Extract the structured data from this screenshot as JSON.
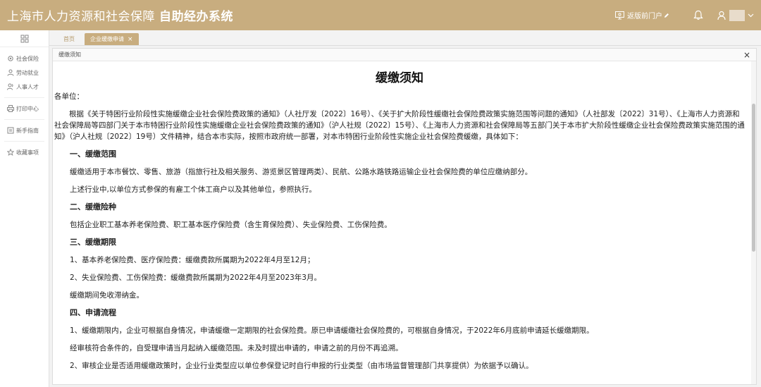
{
  "header": {
    "title_main": "上海市人力资源和社会保障",
    "title_sub": "自助经办系统",
    "link_label": "返版前门户",
    "colors": {
      "brand": "#c8ad7f"
    }
  },
  "sidebar": {
    "items": [
      {
        "label": "社会保险",
        "icon": "gear-icon"
      },
      {
        "label": "劳动就业",
        "icon": "person-icon"
      },
      {
        "label": "人事人才",
        "icon": "people-icon"
      },
      {
        "label": "打印中心",
        "icon": "printer-icon"
      },
      {
        "label": "新手指南",
        "icon": "guide-icon"
      },
      {
        "label": "收藏事项",
        "icon": "star-icon"
      }
    ]
  },
  "tabs": [
    {
      "label": "首页"
    },
    {
      "label": "企业缓缴申请"
    }
  ],
  "panel": {
    "title": "缓缴须知"
  },
  "doc": {
    "title": "缓缴须知",
    "salutation": "各单位：",
    "intro": "根据《关于特困行业阶段性实施缓缴企业社会保险费政策的通知》（人社厅发〔2022〕16号）、《关于扩大阶段性缓缴社会保险费政策实施范围等问题的通知》（人社部发〔2022〕31号）、《上海市人力资源和社会保障局等四部门关于本市特困行业阶段性实施缓缴企业社会保险费政策的通知》（沪人社规〔2022〕15号）、《上海市人力资源和社会保障局等五部门关于本市扩大阶段性缓缴企业社会保险费政策实施范围的通知》（沪人社规〔2022〕19号）文件精神，结合本市实际，按照市政府统一部署，对本市特困行业阶段性实施企业社会保险费缓缴，具体如下：",
    "sections": [
      {
        "heading": "一、缓缴范围",
        "items": [
          "缓缴适用于本市餐饮、零售、旅游（指旅行社及相关服务、游览景区管理两类）、民航、公路水路铁路运输企业社会保险费的单位应缴纳部分。",
          "上述行业中,以单位方式参保的有雇工个体工商户以及其他单位，参照执行。"
        ]
      },
      {
        "heading": "二、缓缴险种",
        "items": [
          "包括企业职工基本养老保险费、职工基本医疗保险费（含生育保险费）、失业保险费、工伤保险费。"
        ]
      },
      {
        "heading": "三、缓缴期限",
        "items": [
          "1、基本养老保险费、医疗保险费：缓缴费款所属期为2022年4月至12月；",
          "2、失业保险费、工伤保险费：缓缴费款所属期为2022年4月至2023年3月。",
          "缓缴期间免收滞纳金。"
        ]
      },
      {
        "heading": "四、申请流程",
        "items": [
          "1、缓缴期限内，企业可根据自身情况，申请缓缴一定期限的社会保险费。原已申请缓缴社会保险费的，可根据自身情况，于2022年6月底前申请延长缓缴期限。",
          "经审核符合条件的，自受理申请当月起纳入缓缴范围。未及时提出申请的，申请之前的月份不再追溯。",
          "2、审核企业是否适用缓缴政策时，企业行业类型应以单位参保登记时自行申报的行业类型（由市场监督管理部门共享提供）为依据予以确认。"
        ]
      }
    ]
  }
}
